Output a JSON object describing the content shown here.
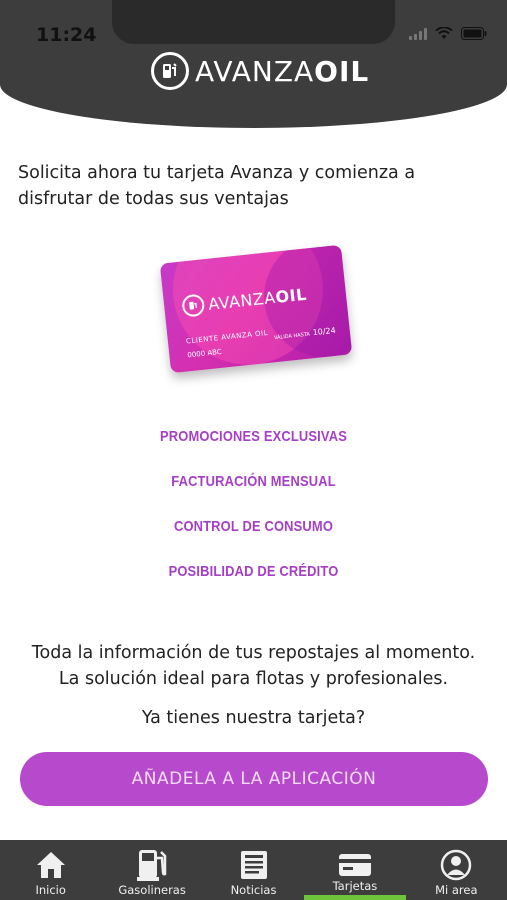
{
  "status_bar": {
    "time": "11:24"
  },
  "header": {
    "logo_light": "AVANZA",
    "logo_bold": "OIL"
  },
  "intro_text": "Solicita ahora tu tarjeta Avanza y comienza a disfrutar de todas sus ventajas",
  "card": {
    "logo_light": "AVANZA",
    "logo_bold": "OIL",
    "client_label": "CLIENTE AVANZA OIL",
    "number": "0000 ABC",
    "valid_label": "VÁLIDA HASTA",
    "valid_date": "10/24"
  },
  "features": [
    "PROMOCIONES EXCLUSIVAS",
    "FACTURACIÓN MENSUAL",
    "CONTROL DE CONSUMO",
    "POSIBILIDAD DE CRÉDITO"
  ],
  "info": {
    "line1": "Toda la información de tus repostajes al momento.",
    "line2": "La solución ideal para flotas y profesionales."
  },
  "question": "Ya tienes nuestra tarjeta?",
  "cta_label": "AÑADELA A LA APLICACIÓN",
  "tabs": [
    {
      "label": "Inicio",
      "icon": "home-icon",
      "active": false
    },
    {
      "label": "Gasolineras",
      "icon": "fuel-pump-icon",
      "active": false
    },
    {
      "label": "Noticias",
      "icon": "news-icon",
      "active": false
    },
    {
      "label": "Tarjetas",
      "icon": "card-icon",
      "active": true
    },
    {
      "label": "Mi area",
      "icon": "user-icon",
      "active": false
    }
  ],
  "colors": {
    "accent": "#b649cc",
    "feature_text": "#a63ec6",
    "header_bg": "#3d3d3d",
    "tab_indicator": "#6ec33a"
  }
}
